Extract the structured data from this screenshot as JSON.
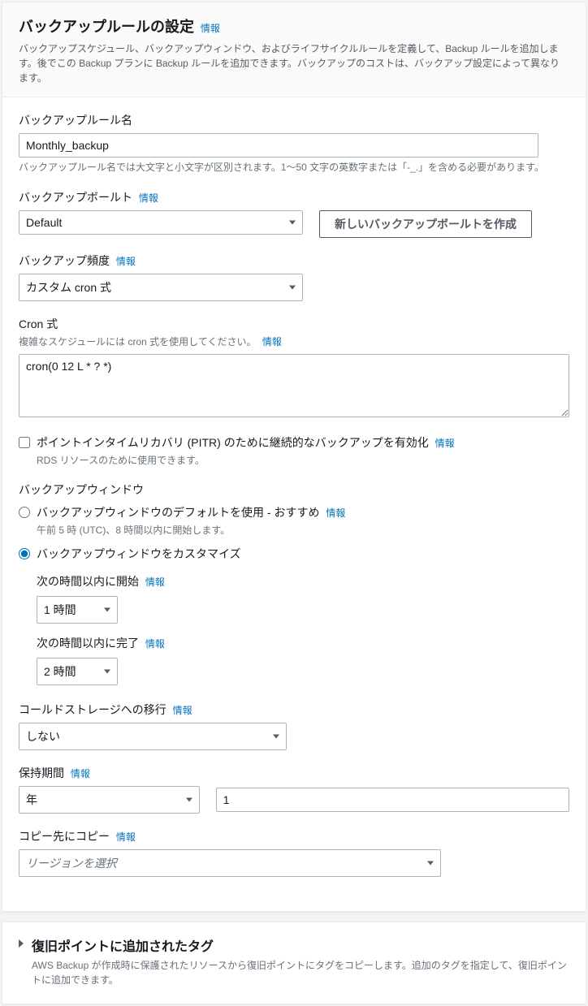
{
  "panel": {
    "title": "バックアップルールの設定",
    "title_info": "情報",
    "desc": "バックアップスケジュール、バックアップウィンドウ、およびライフサイクルルールを定義して、Backup ルールを追加します。後でこの Backup プランに Backup ルールを追加できます。バックアップのコストは、バックアップ設定によって異なります。"
  },
  "rule_name": {
    "label": "バックアップルール名",
    "value": "Monthly_backup",
    "helper": "バックアップルール名では大文字と小文字が区別されます。1～50 文字の英数字または「-_.」を含める必要があります。"
  },
  "vault": {
    "label": "バックアップボールト",
    "info": "情報",
    "selected": "Default",
    "create_button": "新しいバックアップボールトを作成"
  },
  "frequency": {
    "label": "バックアップ頻度",
    "info": "情報",
    "selected": "カスタム cron 式"
  },
  "cron": {
    "label": "Cron 式",
    "helper": "複雑なスケジュールには cron 式を使用してください。",
    "helper_info": "情報",
    "value": "cron(0 12 L * ? *)"
  },
  "pitr": {
    "label": "ポイントインタイムリカバリ (PITR) のために継続的なバックアップを有効化",
    "info": "情報",
    "helper": "RDS リソースのために使用できます。"
  },
  "window": {
    "heading": "バックアップウィンドウ",
    "option_default": "バックアップウィンドウのデフォルトを使用 - おすすめ",
    "option_default_info": "情報",
    "option_default_sub": "午前 5 時 (UTC)、8 時間以内に開始します。",
    "option_custom": "バックアップウィンドウをカスタマイズ",
    "start": {
      "label": "次の時間以内に開始",
      "info": "情報",
      "selected": "1 時間"
    },
    "complete": {
      "label": "次の時間以内に完了",
      "info": "情報",
      "selected": "2 時間"
    }
  },
  "cold": {
    "label": "コールドストレージへの移行",
    "info": "情報",
    "selected": "しない"
  },
  "retention": {
    "label": "保持期間",
    "info": "情報",
    "unit": "年",
    "value": "1"
  },
  "copy": {
    "label": "コピー先にコピー",
    "info": "情報",
    "placeholder": "リージョンを選択"
  },
  "tags_panel": {
    "title": "復旧ポイントに追加されたタグ",
    "desc": "AWS Backup が作成時に保護されたリソースから復旧ポイントにタグをコピーします。追加のタグを指定して、復旧ポイントに追加できます。"
  }
}
